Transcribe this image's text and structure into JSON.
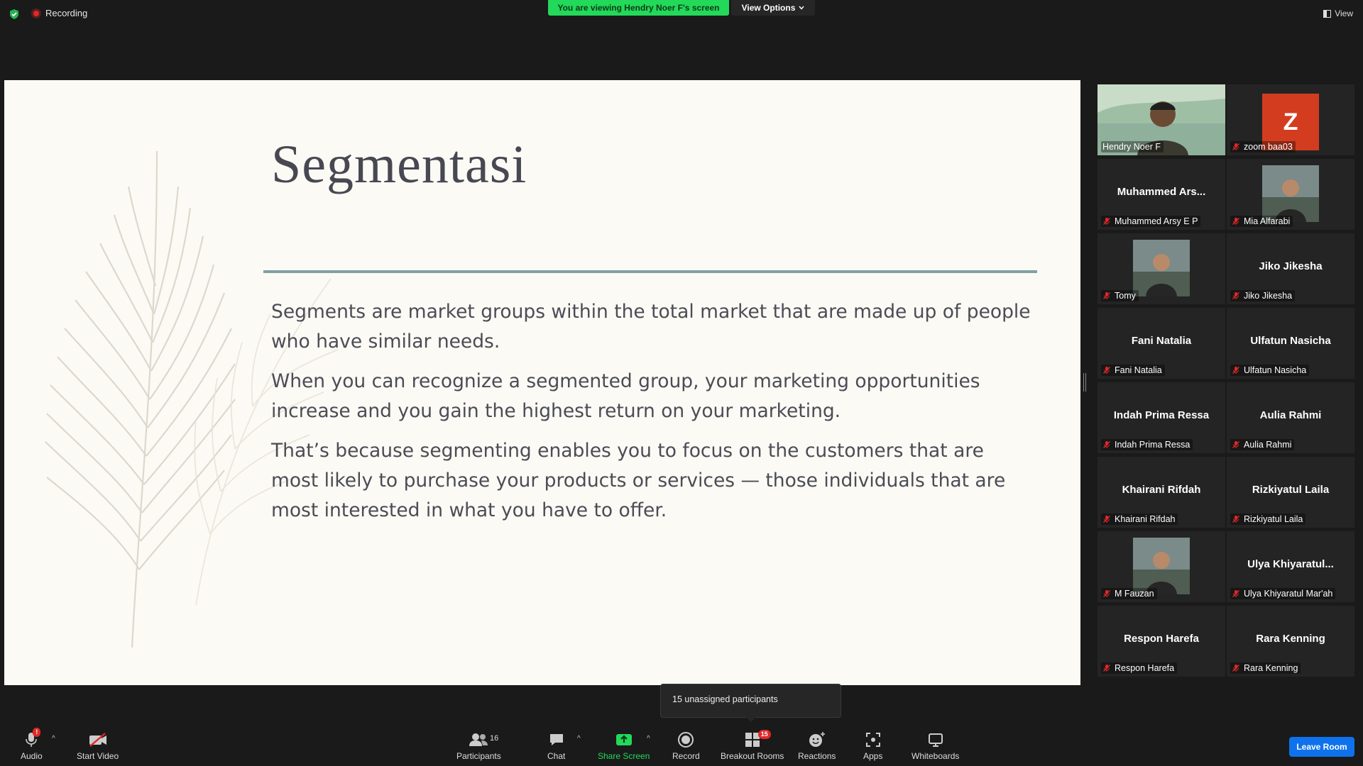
{
  "topbar": {
    "recording_label": "Recording",
    "viewing_banner": "You are viewing Hendry Noer F's screen",
    "view_options_label": "View Options",
    "view_label": "View"
  },
  "slide": {
    "title": "Segmentasi",
    "paragraphs": [
      "Segments are market groups within the total market that are made up of people who have similar needs.",
      "When you can recognize a segmented group, your marketing opportunities increase and you gain the highest return on your marketing.",
      "That’s because segmenting enables you to focus on the customers that are most likely to purchase your products or services — those individuals that are most interested in what you have to offer."
    ]
  },
  "gallery": {
    "tiles": [
      {
        "name": "Hendry Noer F",
        "display": "",
        "kind": "video",
        "muted": false,
        "active": true
      },
      {
        "name": "zoom baa03",
        "display": "Z",
        "kind": "avatar",
        "muted": true,
        "active": false
      },
      {
        "name": "Muhammed Arsy E P",
        "display": "Muhammed  Ars...",
        "kind": "text",
        "muted": true,
        "active": false
      },
      {
        "name": "Mia Alfarabi",
        "display": "",
        "kind": "photo",
        "muted": true,
        "active": false
      },
      {
        "name": "Tomy",
        "display": "",
        "kind": "photo",
        "muted": true,
        "active": false
      },
      {
        "name": "Jiko Jikesha",
        "display": "Jiko Jikesha",
        "kind": "text",
        "muted": true,
        "active": false
      },
      {
        "name": "Fani Natalia",
        "display": "Fani Natalia",
        "kind": "text",
        "muted": true,
        "active": false
      },
      {
        "name": "Ulfatun Nasicha",
        "display": "Ulfatun Nasicha",
        "kind": "text",
        "muted": true,
        "active": false
      },
      {
        "name": "Indah Prima Ressa",
        "display": "Indah Prima Ressa",
        "kind": "text",
        "muted": true,
        "active": false
      },
      {
        "name": "Aulia Rahmi",
        "display": "Aulia Rahmi",
        "kind": "text",
        "muted": true,
        "active": false
      },
      {
        "name": "Khairani Rifdah",
        "display": "Khairani Rifdah",
        "kind": "text",
        "muted": true,
        "active": false
      },
      {
        "name": "Rizkiyatul Laila",
        "display": "Rizkiyatul Laila",
        "kind": "text",
        "muted": true,
        "active": false
      },
      {
        "name": "M Fauzan",
        "display": "",
        "kind": "photo",
        "muted": true,
        "active": false
      },
      {
        "name": "Ulya Khiyaratul Mar'ah",
        "display": "Ulya  Khiyaratul...",
        "kind": "text",
        "muted": true,
        "active": false
      },
      {
        "name": "Respon Harefa",
        "display": "Respon Harefa",
        "kind": "text",
        "muted": true,
        "active": false
      },
      {
        "name": "Rara Kenning",
        "display": "Rara Kenning",
        "kind": "text",
        "muted": true,
        "active": false
      }
    ]
  },
  "tooltip": {
    "text": "15 unassigned participants"
  },
  "toolbar": {
    "audio_label": "Audio",
    "audio_badge": "!",
    "start_video_label": "Start Video",
    "participants_label": "Participants",
    "participants_count": "16",
    "chat_label": "Chat",
    "share_screen_label": "Share Screen",
    "record_label": "Record",
    "breakout_rooms_label": "Breakout Rooms",
    "breakout_badge": "15",
    "reactions_label": "Reactions",
    "apps_label": "Apps",
    "whiteboards_label": "Whiteboards",
    "leave_label": "Leave Room"
  },
  "colors": {
    "accent_green": "#23d959",
    "active_speaker": "#d5f06b",
    "leave_blue": "#0e72ed",
    "mute_red": "#e02828"
  }
}
